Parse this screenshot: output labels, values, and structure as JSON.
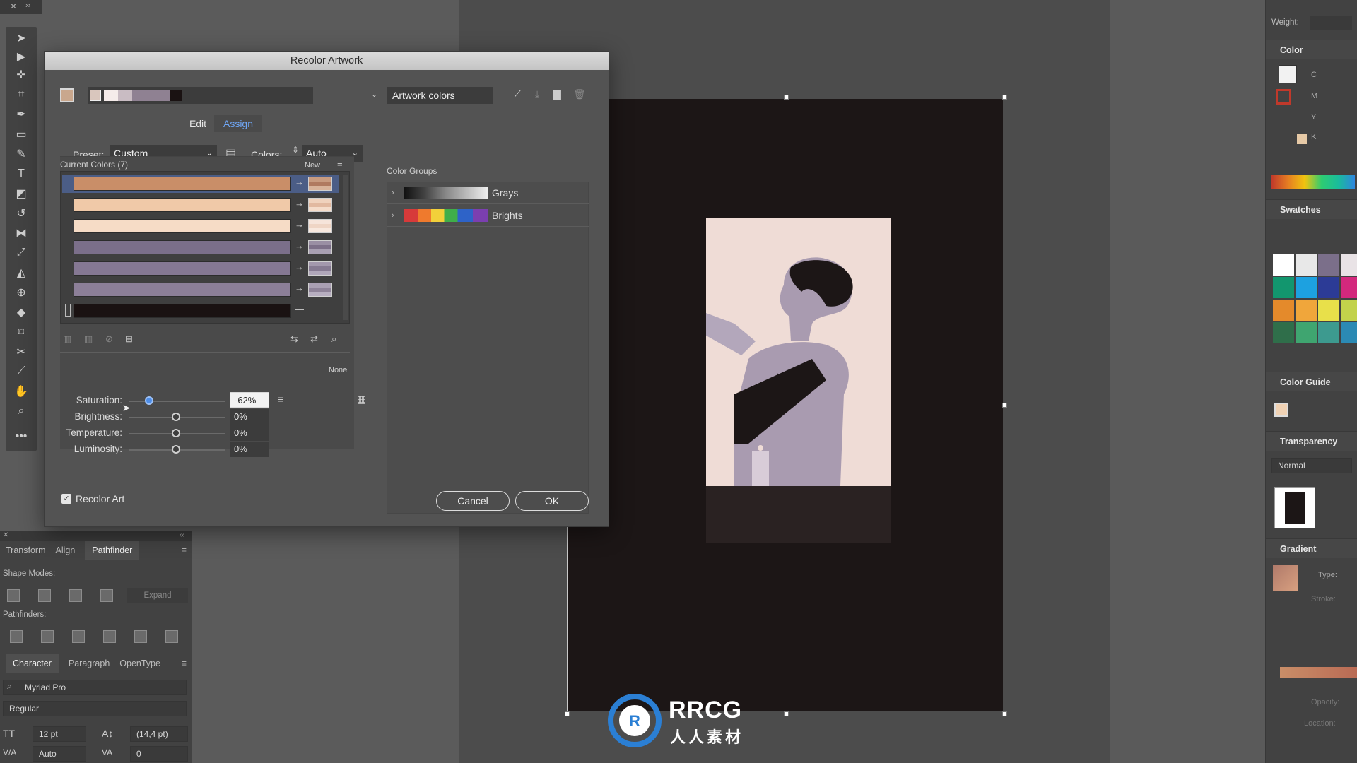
{
  "dialog": {
    "title": "Recolor Artwork",
    "edit_tab": "Edit",
    "assign_tab": "Assign",
    "preset_label": "Preset:",
    "preset_value": "Custom",
    "colors_label": "Colors:",
    "colors_value": "Auto",
    "current_colors_label": "Current Colors (7)",
    "new_label": "New",
    "none_label": "None",
    "artwork_colors": "Artwork colors",
    "color_groups_label": "Color Groups",
    "groups": [
      {
        "name": "Grays"
      },
      {
        "name": "Brights"
      }
    ],
    "current_colors": [
      {
        "color": "#c98e68"
      },
      {
        "color": "#f0c9a8"
      },
      {
        "color": "#f6dcc6"
      },
      {
        "color": "#7b6f8a"
      },
      {
        "color": "#857893"
      },
      {
        "color": "#8c7f98"
      },
      {
        "color": "#1a1212"
      }
    ],
    "adjust": [
      {
        "label": "Saturation:",
        "value": "-62%",
        "level": -62
      },
      {
        "label": "Brightness:",
        "value": "0%",
        "level": 0
      },
      {
        "label": "Temperature:",
        "value": "0%",
        "level": 0
      },
      {
        "label": "Luminosity:",
        "value": "0%",
        "level": 0
      }
    ],
    "recolor_art_label": "Recolor Art",
    "cancel_label": "Cancel",
    "ok_label": "OK"
  },
  "left_panel": {
    "tabs1": [
      "Transform",
      "Align",
      "Pathfinder"
    ],
    "shape_modes_label": "Shape Modes:",
    "expand_label": "Expand",
    "pathfinders_label": "Pathfinders:",
    "tabs2": [
      "Character",
      "Paragraph",
      "OpenType"
    ],
    "font_family": "Myriad Pro",
    "font_style": "Regular",
    "font_size": "12 pt",
    "leading": "(14,4 pt)",
    "kerning": "Auto",
    "tracking": "0"
  },
  "right_panel": {
    "weight_label": "Weight:",
    "color_title": "Color",
    "cmyk": [
      "C",
      "M",
      "Y",
      "K"
    ],
    "swatches_title": "Swatches",
    "color_guide_title": "Color Guide",
    "transparency_title": "Transparency",
    "blend_mode": "Normal",
    "gradient_title": "Gradient",
    "type_label": "Type:",
    "stroke_label": "Stroke:",
    "opacity_label": "Opacity:",
    "location_label": "Location:"
  },
  "watermark": {
    "brand": "RRCG",
    "sub": "人人素材"
  },
  "colors": {
    "accent": "#4e8ee8",
    "artboard": "#1c1616",
    "dialog_bg": "#535353"
  }
}
